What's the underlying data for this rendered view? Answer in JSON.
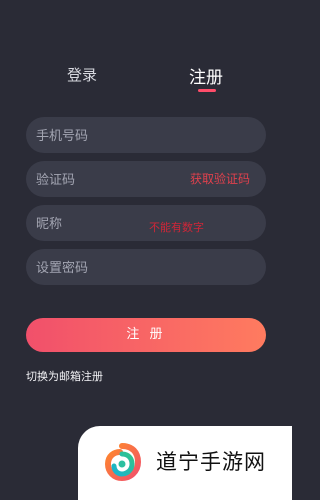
{
  "tabs": {
    "login": "登录",
    "register": "注册"
  },
  "form": {
    "phone_placeholder": "手机号码",
    "code_placeholder": "验证码",
    "get_code": "获取验证码",
    "nickname_placeholder": "昵称",
    "nickname_hint": "不能有数字",
    "password_placeholder": "设置密码"
  },
  "actions": {
    "register": "注 册",
    "switch_email": "切换为邮箱注册"
  },
  "watermark": {
    "text": "道宁手游网"
  },
  "colors": {
    "background": "#2a2b36",
    "field_bg": "#3a3c49",
    "accent_red": "#ff4d6a",
    "gradient_start": "#f1506b",
    "gradient_end": "#ff7b5f"
  }
}
